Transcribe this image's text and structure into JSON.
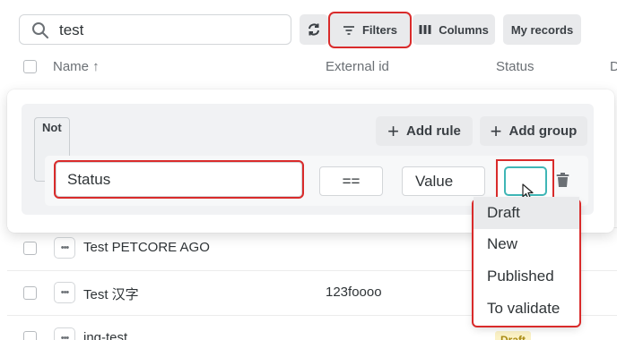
{
  "toolbar": {
    "search_value": "test",
    "filters_label": "Filters",
    "columns_label": "Columns",
    "my_records_label": "My records"
  },
  "table": {
    "headers": {
      "name": "Name ↑",
      "external_id": "External id",
      "status": "Status",
      "partial": "D"
    },
    "rows": [
      {
        "name": "Test PETCORE AGO",
        "external_id": "",
        "status": ""
      },
      {
        "name": "Test 汉字",
        "external_id": "123foooo",
        "status": ""
      },
      {
        "name": "ing-test",
        "external_id": "",
        "status": "Draft"
      }
    ]
  },
  "filter_panel": {
    "not_label": "Not",
    "add_rule_label": "Add rule",
    "add_group_label": "Add group",
    "rule": {
      "field_value": "Status",
      "operator_value": "==",
      "value_value": "Value"
    },
    "status_options": [
      "Draft",
      "New",
      "Published",
      "To validate"
    ],
    "highlighted_option": "Draft"
  },
  "colors": {
    "highlight_outline": "#d92b2b",
    "focus_border": "#3fb6b6",
    "draft_badge": "#fbf2c6"
  }
}
